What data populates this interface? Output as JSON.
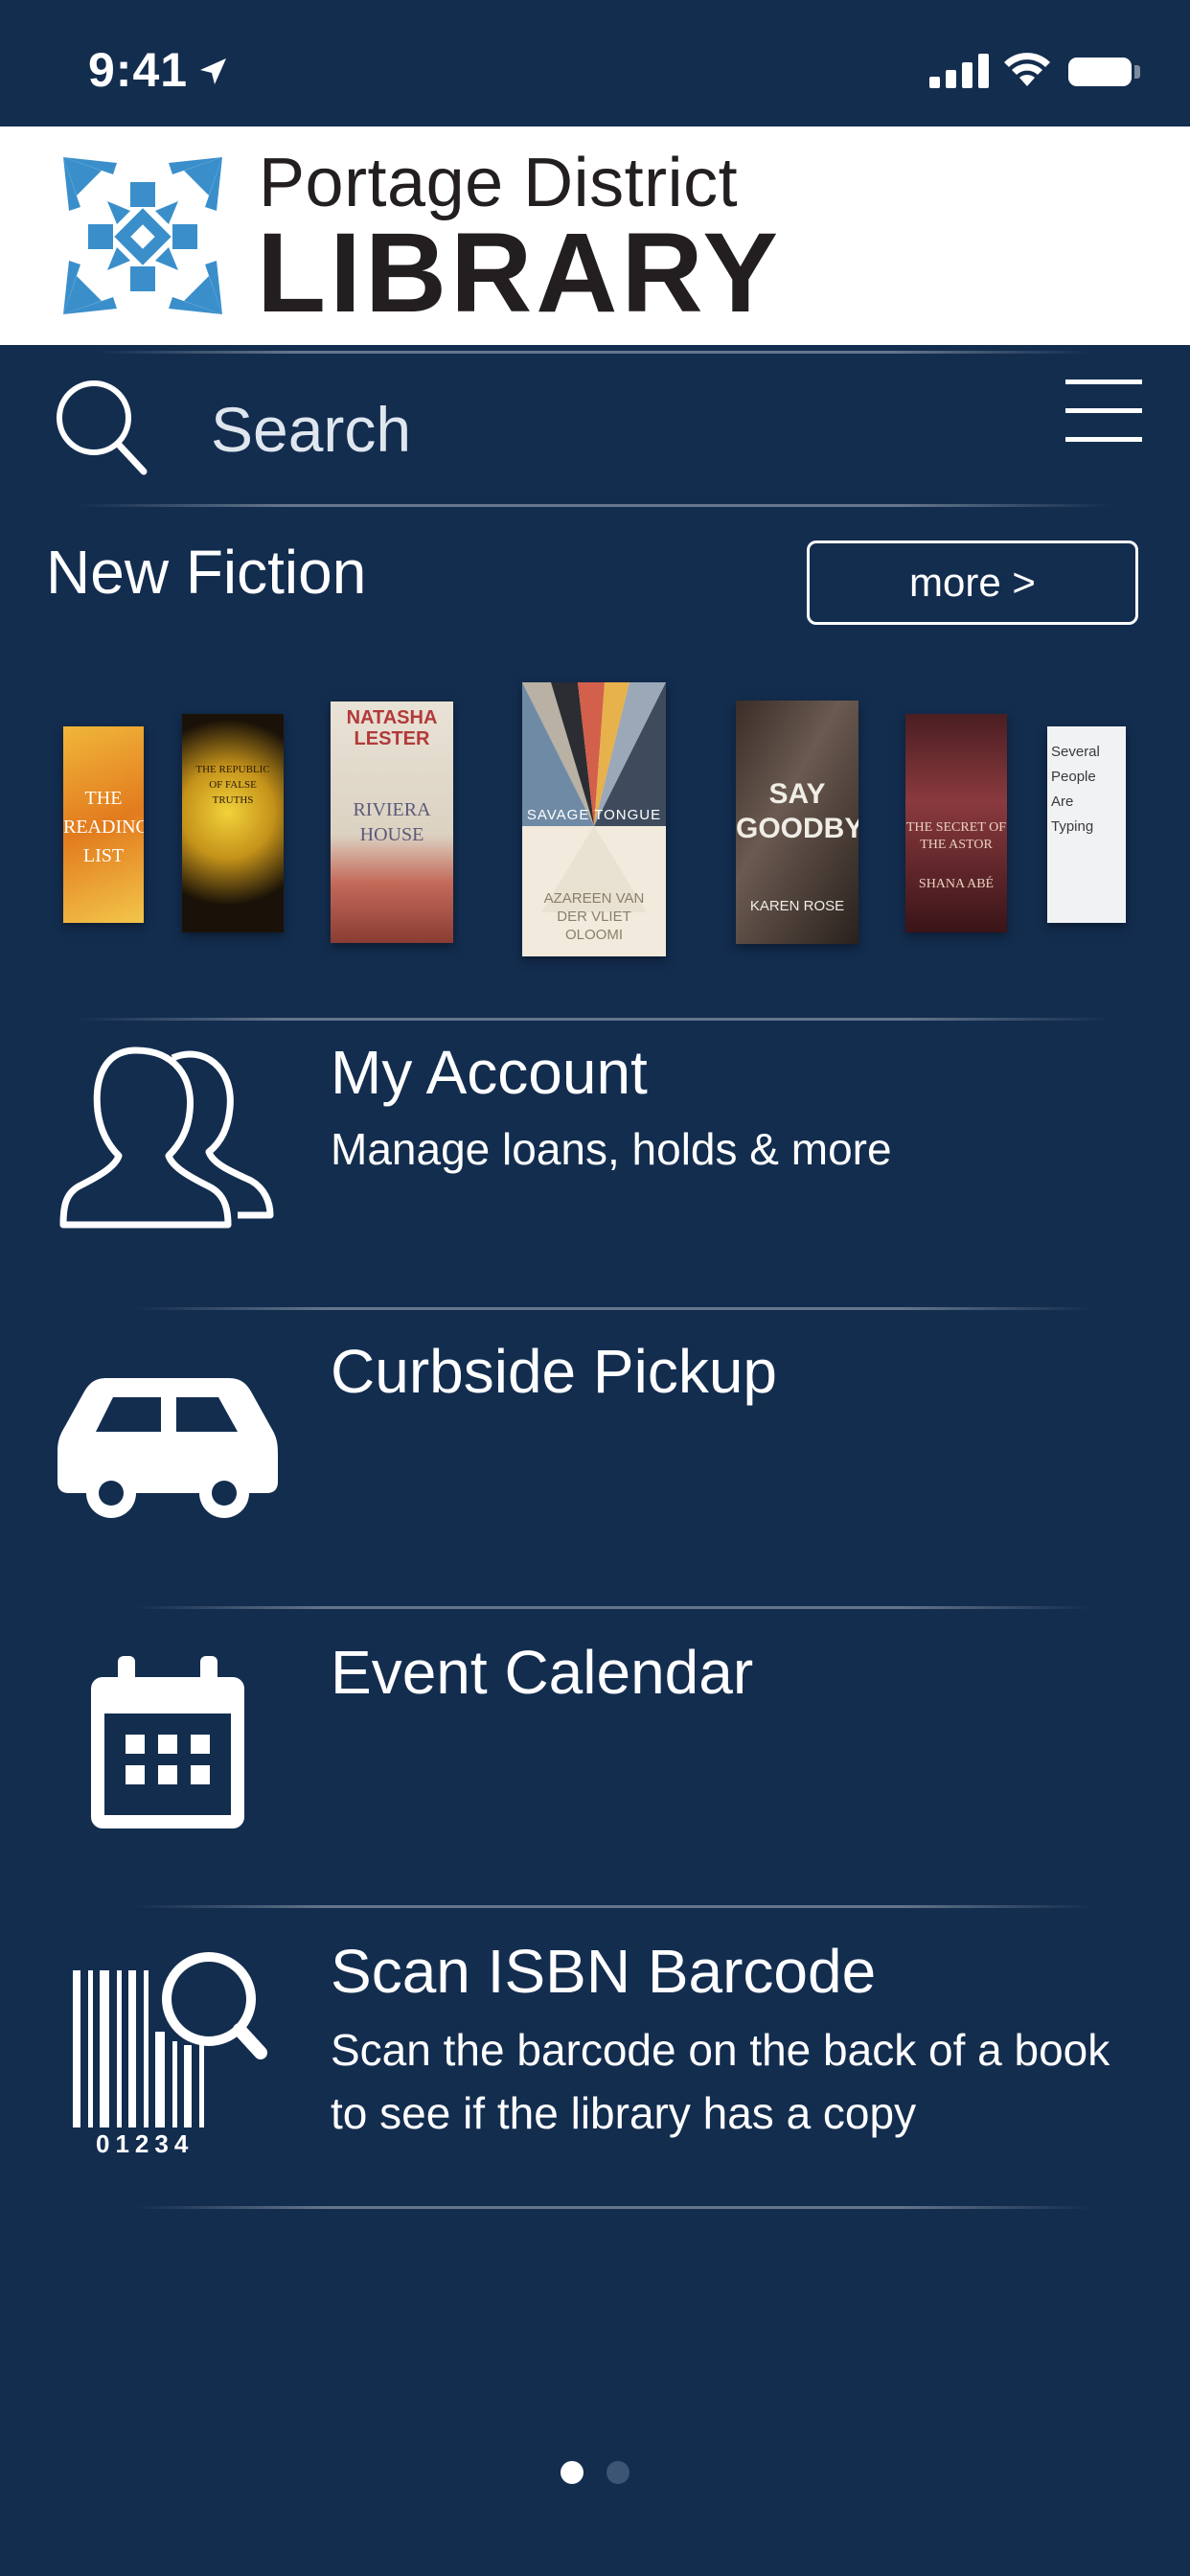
{
  "status_bar": {
    "time": "9:41",
    "icons": [
      "location-arrow-icon",
      "signal-icon",
      "wifi-icon",
      "battery-icon"
    ]
  },
  "header": {
    "logo_line1": "Portage District",
    "logo_line2": "LIBRARY",
    "logo_color": "#3a8fcb"
  },
  "search": {
    "placeholder": "Search"
  },
  "new_fiction": {
    "title": "New Fiction",
    "more_label": "more >",
    "covers": [
      {
        "text": "THE READING LIST"
      },
      {
        "text": "THE REPUBLIC OF FALSE TRUTHS"
      },
      {
        "text": "NATASHA LESTER",
        "subtitle": "RIVIERA HOUSE"
      },
      {
        "text": "SAVAGE TONGUE",
        "subtitle": "AZAREEN VAN DER VLIET OLOOMI"
      },
      {
        "text": "SAY GOODBYE",
        "subtitle": "KAREN ROSE"
      },
      {
        "text": "THE SECRET OF THE ASTOR",
        "subtitle": "SHANA ABÉ"
      },
      {
        "text": "Several People Are Typing"
      }
    ]
  },
  "menu": [
    {
      "title": "My Account",
      "subtitle": "Manage loans, holds & more",
      "icon": "account-icon"
    },
    {
      "title": "Curbside Pickup",
      "subtitle": "",
      "icon": "car-icon"
    },
    {
      "title": "Event Calendar",
      "subtitle": "",
      "icon": "calendar-icon"
    },
    {
      "title": "Scan ISBN Barcode",
      "subtitle": "Scan the barcode on the back of a book to see if the library has a copy",
      "icon": "barcode-scan-icon",
      "barcode_digits": "01234"
    }
  ],
  "page_indicator": {
    "current": 1,
    "total": 2
  }
}
